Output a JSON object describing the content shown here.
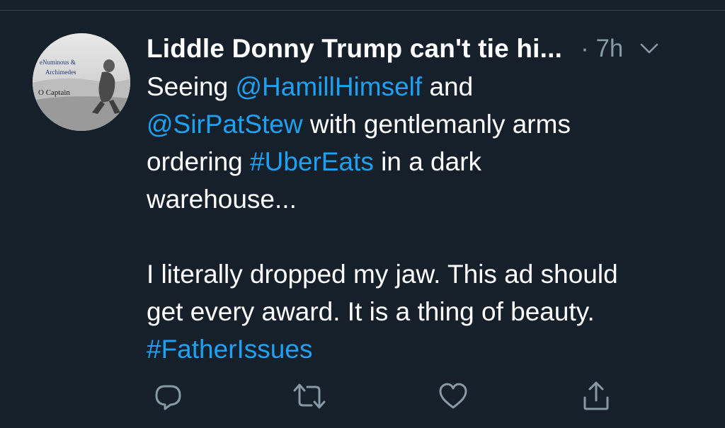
{
  "avatar": {
    "caption_line1": "eNuminous &",
    "caption_line2": "Archimedes",
    "caption_line3": "O Captain"
  },
  "tweet": {
    "author_name": "Liddle Donny Trump can't tie hi...",
    "separator_time": "· 7h",
    "lines": [
      [
        {
          "t": "Seeing ",
          "link": false
        },
        {
          "t": "@HamillHimself",
          "link": true
        },
        {
          "t": " and",
          "link": false
        }
      ],
      [
        {
          "t": "@SirPatStew",
          "link": true
        },
        {
          "t": " with gentlemanly arms",
          "link": false
        }
      ],
      [
        {
          "t": "ordering ",
          "link": false
        },
        {
          "t": "#UberEats",
          "link": true
        },
        {
          "t": " in a dark",
          "link": false
        }
      ],
      [
        {
          "t": "warehouse...",
          "link": false
        }
      ],
      [],
      [
        {
          "t": "I literally dropped my jaw. This ad should",
          "link": false
        }
      ],
      [
        {
          "t": "get every award. It is a thing of beauty.",
          "link": false
        }
      ],
      [
        {
          "t": "#FatherIssues",
          "link": true
        }
      ]
    ]
  },
  "actions": {
    "reply_icon": "reply-icon",
    "retweet_icon": "retweet-icon",
    "like_icon": "heart-icon",
    "share_icon": "share-icon"
  },
  "colors": {
    "background": "#15202b",
    "link": "#1da1f2",
    "muted": "#8899a6",
    "text": "#ffffff"
  }
}
